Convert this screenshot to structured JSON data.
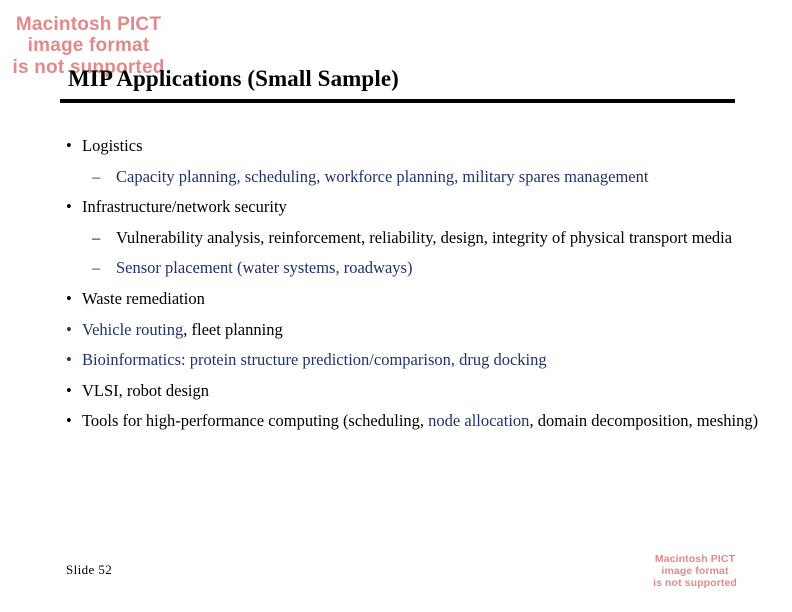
{
  "slide": {
    "title": "MIP Applications (Small Sample)",
    "slide_number_label": "Slide 52",
    "accent_color": "#1f3468",
    "placeholder_color": "#e08a8a",
    "rule_color": "#000000"
  },
  "pict_placeholder_top": {
    "name": "macintosh-pict-placeholder",
    "line1": "Macintosh PICT",
    "line2": "image format",
    "line3": "is not supported"
  },
  "pict_placeholder_bottom": {
    "name": "macintosh-pict-placeholder",
    "line1": "Macintosh PICT",
    "line2": "image format",
    "line3": "is not supported"
  },
  "bullets": [
    {
      "level": 1,
      "marker": "•",
      "marker_color": "#000000",
      "segments": [
        {
          "text": "Logistics",
          "color": "#000000"
        }
      ]
    },
    {
      "level": 2,
      "marker": "–",
      "marker_color": "#1f3468",
      "segments": [
        {
          "text": "Capacity planning, scheduling, workforce planning, military spares management",
          "color": "#1f3468"
        }
      ]
    },
    {
      "level": 1,
      "marker": "•",
      "marker_color": "#000000",
      "segments": [
        {
          "text": "Infrastructure/network security",
          "color": "#000000"
        }
      ]
    },
    {
      "level": 2,
      "marker": "–",
      "marker_color": "#000000",
      "segments": [
        {
          "text": "Vulnerability analysis, reinforcement, reliability, design, integrity of physical transport media",
          "color": "#000000"
        }
      ]
    },
    {
      "level": 2,
      "marker": "–",
      "marker_color": "#1f3468",
      "segments": [
        {
          "text": "Sensor placement (water systems, roadways)",
          "color": "#1f3468"
        }
      ]
    },
    {
      "level": 1,
      "marker": "•",
      "marker_color": "#000000",
      "segments": [
        {
          "text": "Waste remediation",
          "color": "#000000"
        }
      ]
    },
    {
      "level": 1,
      "marker": "•",
      "marker_color": "#1f3468",
      "segments": [
        {
          "text": "Vehicle routing",
          "color": "#1f3468"
        },
        {
          "text": ", fleet planning",
          "color": "#000000"
        }
      ]
    },
    {
      "level": 1,
      "marker": "•",
      "marker_color": "#1f3468",
      "segments": [
        {
          "text": "Bioinformatics: protein structure prediction/comparison, drug docking",
          "color": "#1f3468"
        }
      ]
    },
    {
      "level": 1,
      "marker": "•",
      "marker_color": "#000000",
      "segments": [
        {
          "text": "VLSI, robot design",
          "color": "#000000"
        }
      ]
    },
    {
      "level": 1,
      "marker": "•",
      "marker_color": "#000000",
      "segments": [
        {
          "text": "Tools for high-performance computing (scheduling, ",
          "color": "#000000"
        },
        {
          "text": "node allocation",
          "color": "#1f3468"
        },
        {
          "text": ", domain decomposition, meshing)",
          "color": "#000000"
        }
      ]
    }
  ]
}
